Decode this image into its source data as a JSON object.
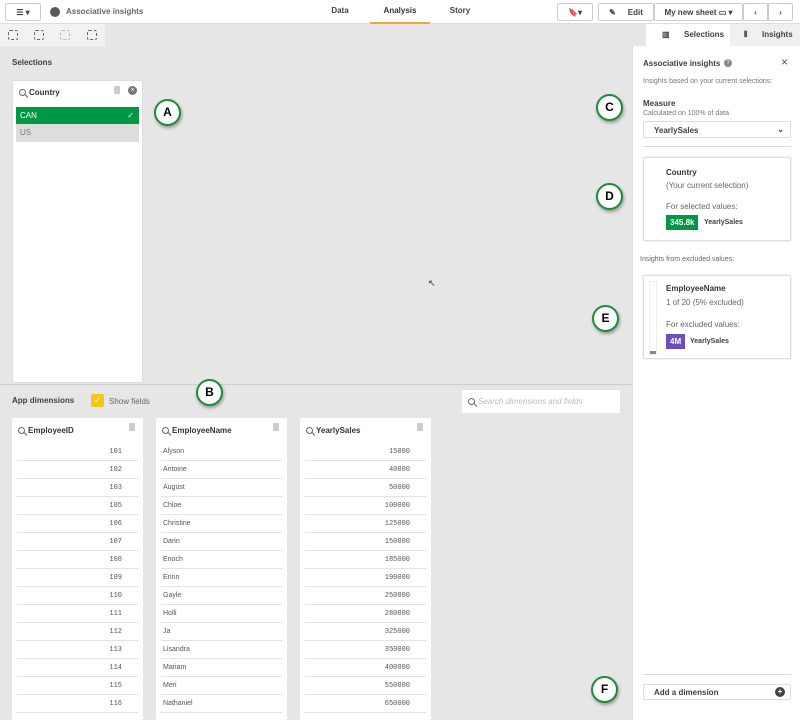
{
  "topbar": {
    "app_title": "Associative insights",
    "tabs": [
      "Data",
      "Analysis",
      "Story"
    ],
    "active_tab": "Analysis",
    "edit_label": "Edit",
    "sheet_name": "My new sheet"
  },
  "right_tabs": {
    "selections": "Selections",
    "insights": "Insights"
  },
  "selections": {
    "title": "Selections",
    "field": "Country",
    "values": [
      {
        "label": "CAN",
        "selected": true
      },
      {
        "label": "US",
        "selected": false
      }
    ]
  },
  "app_dimensions": {
    "title": "App dimensions",
    "show_fields_label": "Show fields",
    "search_placeholder": "Search dimensions and fields",
    "columns": [
      {
        "name": "EmployeeID",
        "values": [
          "101",
          "102",
          "103",
          "105",
          "106",
          "107",
          "108",
          "109",
          "110",
          "111",
          "112",
          "113",
          "114",
          "115",
          "116"
        ]
      },
      {
        "name": "EmployeeName",
        "values": [
          "Alyson",
          "Antoine",
          "August",
          "Chloe",
          "Christine",
          "Darin",
          "Enoch",
          "Erinn",
          "Gayle",
          "Holli",
          "Ja",
          "Lisandra",
          "Mariam",
          "Meri",
          "Nathaniel"
        ]
      },
      {
        "name": "YearlySales",
        "values": [
          "15000",
          "40000",
          "50000",
          "100000",
          "125000",
          "150000",
          "185000",
          "190000",
          "250000",
          "280000",
          "325000",
          "350000",
          "400000",
          "550000",
          "650000"
        ]
      }
    ]
  },
  "insights": {
    "title": "Associative insights",
    "subtitle": "Insights based on your current selections:",
    "measure_label": "Measure",
    "measure_note": "Calculated on 100% of data",
    "measure_value": "YearlySales",
    "selected_card": {
      "field": "Country",
      "note": "(Your current selection)",
      "for_label": "For selected values:",
      "value": "345.8k",
      "measure": "YearlySales",
      "color": "#009845"
    },
    "excluded_header": "Insights from excluded values:",
    "excluded_card": {
      "field": "EmployeeName",
      "note": "1 of 20 (5% excluded)",
      "for_label": "For excluded values:",
      "value": "4M",
      "measure": "YearlySales",
      "color": "#6b4fbb"
    },
    "add_dimension": "Add a dimension"
  },
  "callouts": [
    "A",
    "B",
    "C",
    "D",
    "E",
    "F"
  ]
}
